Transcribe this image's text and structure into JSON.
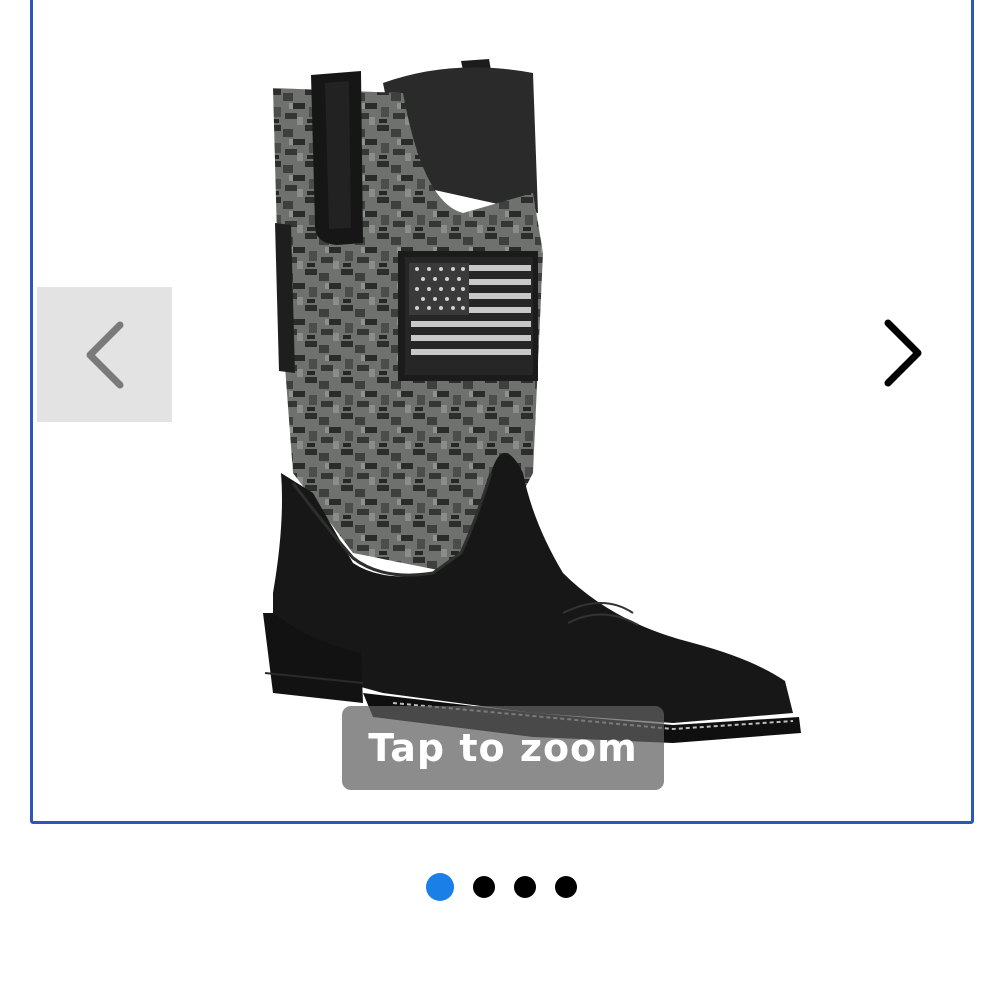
{
  "gallery": {
    "zoom_hint": "Tap to zoom",
    "prev_icon": "chevron-left-icon",
    "next_icon": "chevron-right-icon",
    "image": "square-toe-western-boot-black-camo-flag",
    "dots": [
      {
        "active": true
      },
      {
        "active": false
      },
      {
        "active": false
      },
      {
        "active": false
      }
    ]
  },
  "colors": {
    "frame_border": "#2a57b8",
    "active_dot": "#1a7fe6",
    "inactive_dot": "#000000"
  }
}
